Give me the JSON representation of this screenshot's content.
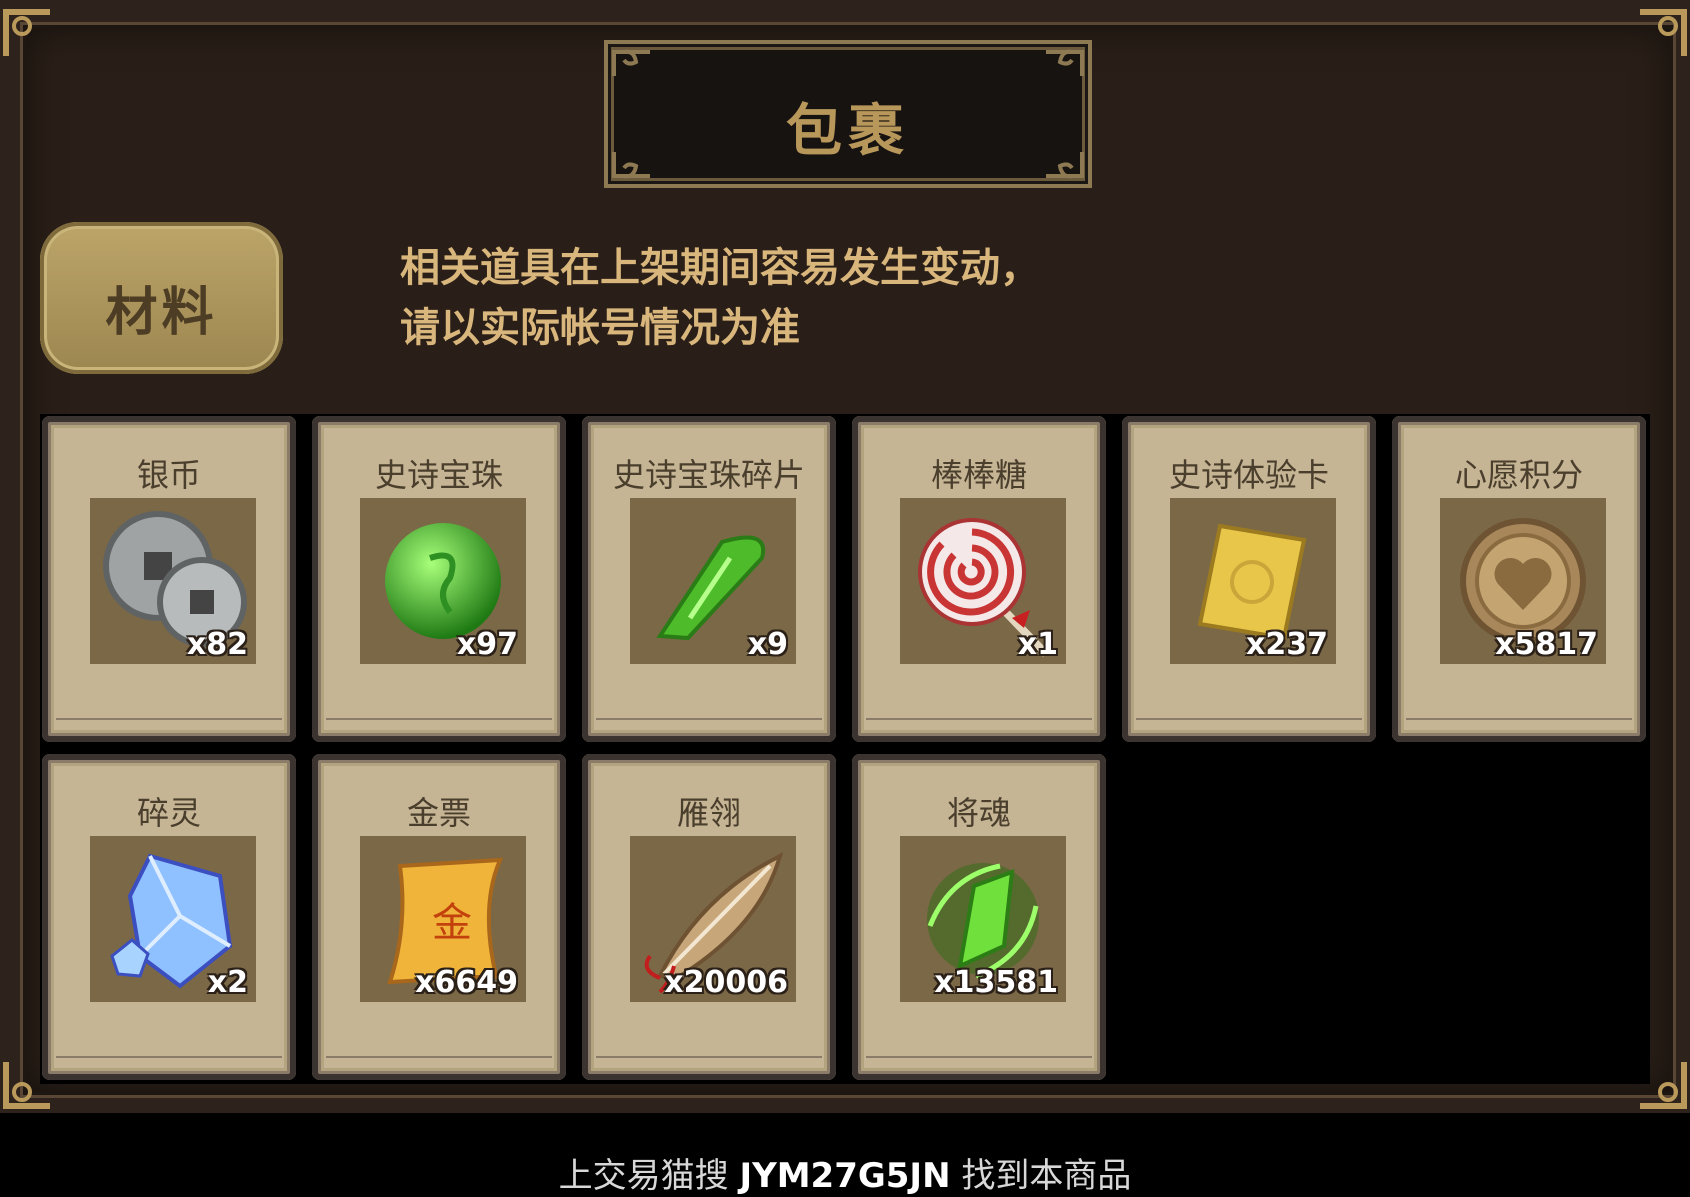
{
  "title": "包裹",
  "tab": {
    "label": "材料"
  },
  "notice": {
    "line1": "相关道具在上架期间容易发生变动，",
    "line2": "请以实际帐号情况为准"
  },
  "items": [
    {
      "name": "银币",
      "qty": "x82",
      "icon": "silver-coin-icon"
    },
    {
      "name": "史诗宝珠",
      "qty": "x97",
      "icon": "green-orb-icon"
    },
    {
      "name": "史诗宝珠碎片",
      "qty": "x9",
      "icon": "green-shard-icon"
    },
    {
      "name": "棒棒糖",
      "qty": "x1",
      "icon": "lollipop-icon"
    },
    {
      "name": "史诗体验卡",
      "qty": "x237",
      "icon": "gold-card-icon"
    },
    {
      "name": "心愿积分",
      "qty": "x5817",
      "icon": "heart-coin-icon"
    },
    {
      "name": "碎灵",
      "qty": "x2",
      "icon": "crystal-icon"
    },
    {
      "name": "金票",
      "qty": "x6649",
      "icon": "gold-scroll-icon"
    },
    {
      "name": "雁翎",
      "qty": "x20006",
      "icon": "feather-icon"
    },
    {
      "name": "将魂",
      "qty": "x13581",
      "icon": "green-spirit-icon"
    }
  ],
  "footer": {
    "prefix": "上交易猫搜 ",
    "code": "JYM27G5JN",
    "suffix": " 找到本商品"
  },
  "colors": {
    "frame": "#2a1f18",
    "card": "#c6b594",
    "title_text": "#b8975a",
    "notice_text": "#d9b67c"
  }
}
